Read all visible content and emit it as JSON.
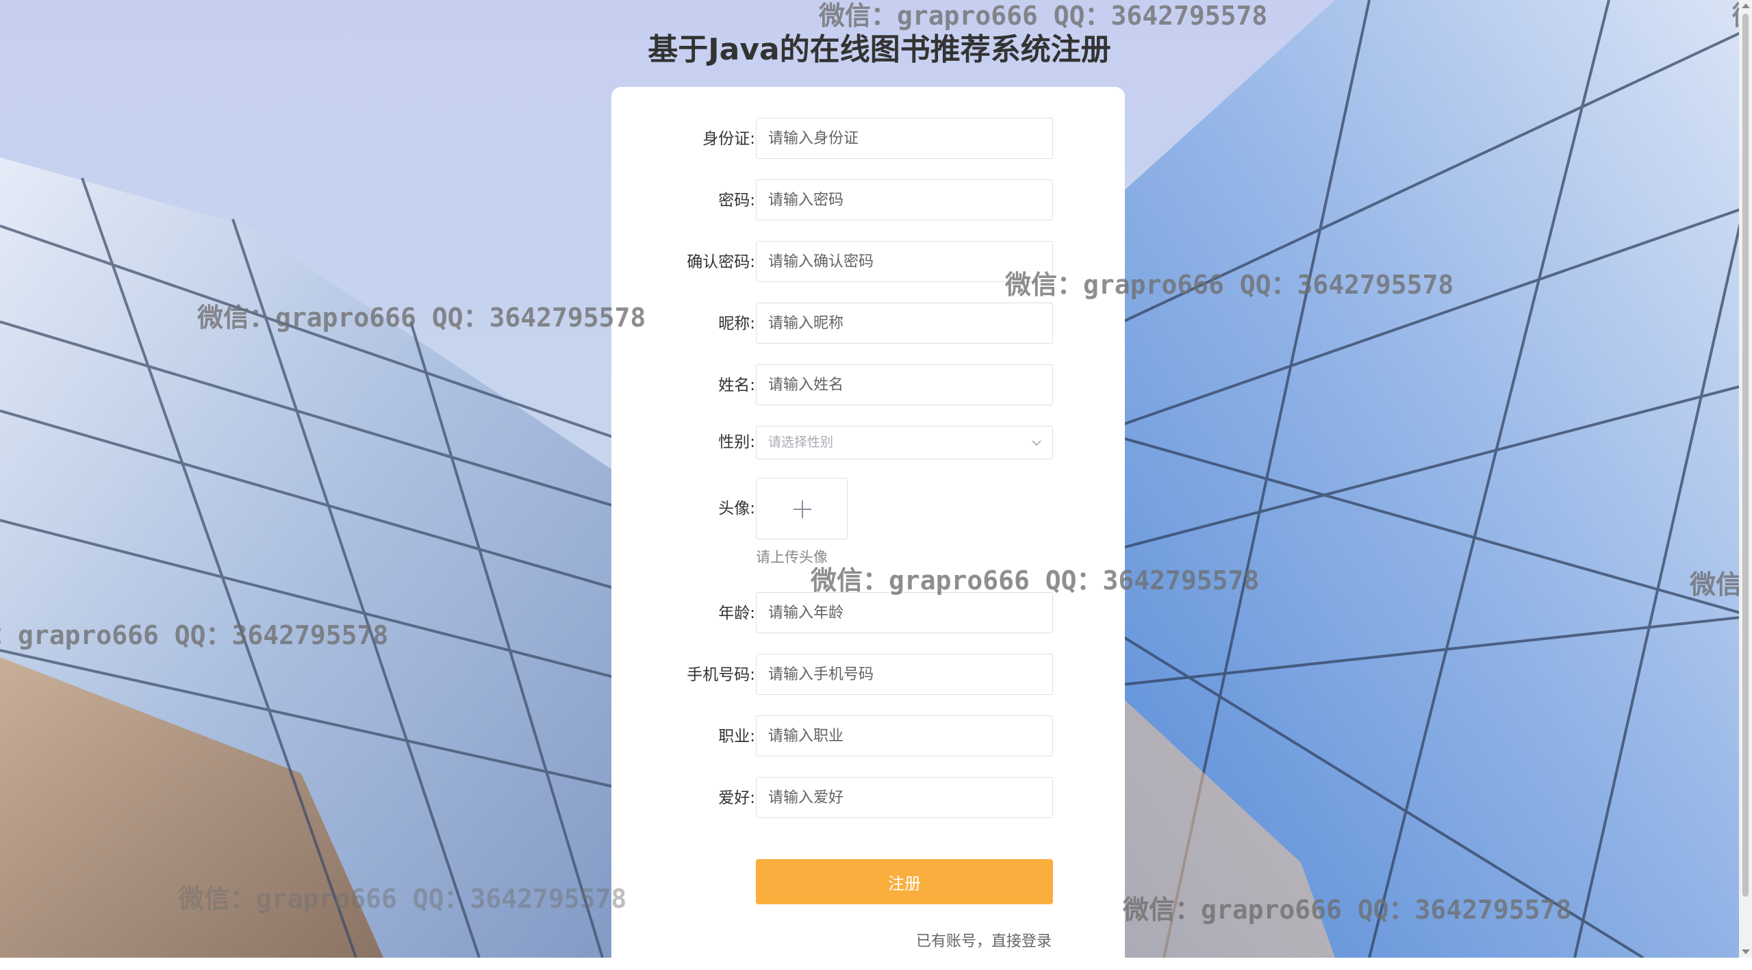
{
  "page": {
    "title": "基于Java的在线图书推荐系统注册"
  },
  "form": {
    "fields": [
      {
        "label": "身份证:",
        "placeholder": "请输入身份证"
      },
      {
        "label": "密码:",
        "placeholder": "请输入密码"
      },
      {
        "label": "确认密码:",
        "placeholder": "请输入确认密码"
      },
      {
        "label": "昵称:",
        "placeholder": "请输入昵称"
      },
      {
        "label": "姓名:",
        "placeholder": "请输入姓名"
      }
    ],
    "gender": {
      "label": "性别:",
      "placeholder": "请选择性别"
    },
    "avatar": {
      "label": "头像:",
      "hint": "请上传头像"
    },
    "fields2": [
      {
        "label": "年龄:",
        "placeholder": "请输入年龄"
      },
      {
        "label": "手机号码:",
        "placeholder": "请输入手机号码"
      },
      {
        "label": "职业:",
        "placeholder": "请输入职业"
      },
      {
        "label": "爱好:",
        "placeholder": "请输入爱好"
      }
    ],
    "submit_label": "注册",
    "login_link": "已有账号，直接登录"
  },
  "watermarks": {
    "text": "微信：grapro666 QQ：3642795578",
    "partial_left": "：grapro666 QQ：3642795578",
    "partial_right": "微信："
  },
  "colors": {
    "accent": "#f9ae3d",
    "card": "#ffffff"
  },
  "icons": {
    "select_chevron": "chevron-down-icon",
    "upload": "plus-icon"
  }
}
